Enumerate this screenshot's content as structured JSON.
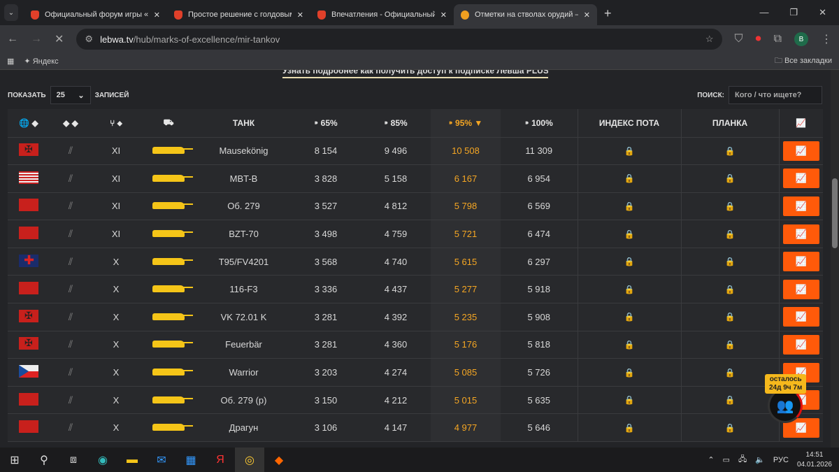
{
  "browser": {
    "tabs": [
      {
        "title": "Официальный форум игры «Мир танков»"
      },
      {
        "title": "Простое решение с голдовыми"
      },
      {
        "title": "Впечатления - Официальный форум"
      },
      {
        "title": "Отметки на стволах орудий —"
      }
    ],
    "url_domain": "lebwa.tv",
    "url_path": "/hub/marks-of-excellence/mir-tankov",
    "profile": "B",
    "bookmark_yandex": "Яндекс",
    "all_bookmarks": "Все закладки"
  },
  "page": {
    "promo": "Узнать подробнее как получить доступ к подписке Левша PLUS",
    "show_label": "ПОКАЗАТЬ",
    "page_size": "25",
    "records_label": "ЗАПИСЕЙ",
    "search_label": "ПОИСК:",
    "search_placeholder": "Кого / что ищете?",
    "columns": {
      "tank": "ТАНК",
      "p65": "65%",
      "p85": "85%",
      "p95": "95%",
      "p100": "100%",
      "index": "ИНДЕКС ПОТА",
      "bar": "ПЛАНКА"
    },
    "rows": [
      {
        "flag": "de",
        "tier": "XI",
        "name": "Mausekönig",
        "p65": "8 154",
        "p85": "9 496",
        "p95": "10 508",
        "p100": "11 309"
      },
      {
        "flag": "us",
        "tier": "XI",
        "name": "MBT-B",
        "p65": "3 828",
        "p85": "5 158",
        "p95": "6 167",
        "p100": "6 954"
      },
      {
        "flag": "su",
        "tier": "XI",
        "name": "Об. 279",
        "p65": "3 527",
        "p85": "4 812",
        "p95": "5 798",
        "p100": "6 569"
      },
      {
        "flag": "su",
        "tier": "XI",
        "name": "BZT-70",
        "p65": "3 498",
        "p85": "4 759",
        "p95": "5 721",
        "p100": "6 474"
      },
      {
        "flag": "gb",
        "tier": "X",
        "name": "T95/FV4201",
        "p65": "3 568",
        "p85": "4 740",
        "p95": "5 615",
        "p100": "6 297"
      },
      {
        "flag": "su",
        "tier": "X",
        "name": "116-F3",
        "p65": "3 336",
        "p85": "4 437",
        "p95": "5 277",
        "p100": "5 918"
      },
      {
        "flag": "de",
        "tier": "X",
        "name": "VK 72.01 K",
        "p65": "3 281",
        "p85": "4 392",
        "p95": "5 235",
        "p100": "5 908"
      },
      {
        "flag": "de",
        "tier": "X",
        "name": "Feuerbär",
        "p65": "3 281",
        "p85": "4 360",
        "p95": "5 176",
        "p100": "5 818"
      },
      {
        "flag": "cz",
        "tier": "X",
        "name": "Warrior",
        "p65": "3 203",
        "p85": "4 274",
        "p95": "5 085",
        "p100": "5 726"
      },
      {
        "flag": "su",
        "tier": "X",
        "name": "Об. 279 (р)",
        "p65": "3 150",
        "p85": "4 212",
        "p95": "5 015",
        "p100": "5 635"
      },
      {
        "flag": "su",
        "tier": "X",
        "name": "Драгун",
        "p65": "3 106",
        "p85": "4 147",
        "p95": "4 977",
        "p100": "5 646"
      }
    ],
    "timer_label": "осталось",
    "timer_value": "24д 9ч 7м"
  },
  "taskbar": {
    "lang": "РУС",
    "time": "14:51",
    "date": "04.01.2026"
  }
}
